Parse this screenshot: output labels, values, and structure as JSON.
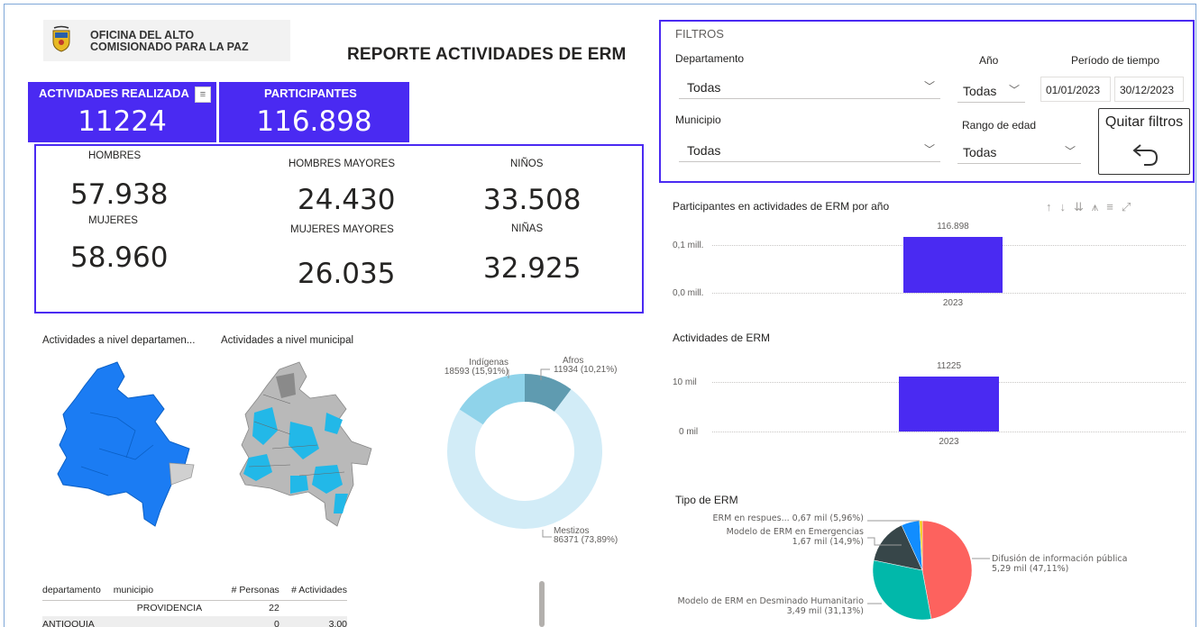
{
  "header": {
    "org_line1": "OFICINA DEL ALTO",
    "org_line2": "COMISIONADO PARA LA PAZ",
    "report_title": "REPORTE ACTIVIDADES DE ERM"
  },
  "kpis": {
    "actividades_label": "ACTIVIDADES REALIZADA",
    "actividades_value": "11224",
    "participantes_label": "PARTICIPANTES",
    "participantes_value": "116.898"
  },
  "stats": {
    "hombres_label": "HOMBRES",
    "hombres_value": "57.938",
    "mujeres_label": "MUJERES",
    "mujeres_value": "58.960",
    "hombres_mayores_label": "HOMBRES MAYORES",
    "hombres_mayores_value": "24.430",
    "mujeres_mayores_label": "MUJERES MAYORES",
    "mujeres_mayores_value": "26.035",
    "ninos_label": "NIÑOS",
    "ninos_value": "33.508",
    "ninas_label": "NIÑAS",
    "ninas_value": "32.925"
  },
  "filters": {
    "title": "FILTROS",
    "departamento_label": "Departamento",
    "departamento_value": "Todas",
    "anio_label": "Año",
    "anio_value": "Todas",
    "periodo_label": "Período de tiempo",
    "fecha_inicio": "01/01/2023",
    "fecha_fin": "30/12/2023",
    "municipio_label": "Municipio",
    "municipio_value": "Todas",
    "rango_label": "Rango de edad",
    "rango_value": "Todas",
    "clear_label": "Quitar filtros"
  },
  "maps": {
    "dept_title": "Actividades a nivel departamen...",
    "muni_title": "Actividades a nivel municipal"
  },
  "donut": {
    "indigenas_name": "Indígenas",
    "indigenas_value": "18593 (15,91%)",
    "afros_name": "Afros",
    "afros_value": "11934 (10,21%)",
    "mestizos_name": "Mestizos",
    "mestizos_value": "86371 (73,89%)",
    "colors": {
      "indigenas": "#8fd3ea",
      "afros": "#5f9bb0",
      "mestizos": "#d2ecf7"
    }
  },
  "chart_data": [
    {
      "type": "bar",
      "title": "Participantes en actividades de ERM por año",
      "categories": [
        "2023"
      ],
      "values": [
        116898
      ],
      "data_labels": [
        "116.898"
      ],
      "y_ticks": [
        "0,0 mill.",
        "0,1 mill."
      ],
      "ylim": [
        0,
        120000
      ]
    },
    {
      "type": "bar",
      "title": "Actividades de ERM",
      "categories": [
        "2023"
      ],
      "values": [
        11225
      ],
      "data_labels": [
        "11225"
      ],
      "y_ticks": [
        "0 mil",
        "10 mil"
      ],
      "ylim": [
        0,
        12500
      ]
    },
    {
      "type": "pie",
      "title": "Tipo de ERM",
      "labels": [
        "Difusión de información pública",
        "Modelo de ERM en Desminado Humanitario",
        "Modelo de ERM en Emergencias",
        "ERM en respues..."
      ],
      "values": [
        47.11,
        31.13,
        14.9,
        5.96
      ],
      "value_labels": [
        "5,29 mil (47,11%)",
        "3,49 mil (31,13%)",
        "1,67 mil (14,9%)",
        "0,67 mil (5,96%)"
      ],
      "colors": [
        "#fd625e",
        "#01b8aa",
        "#374649",
        "#118dff",
        "#f2c80f"
      ]
    }
  ],
  "table": {
    "headers": [
      "departamento",
      "municipio",
      "# Personas",
      "# Actividades"
    ],
    "rows": [
      [
        "",
        "PROVIDENCIA",
        "22",
        ""
      ],
      [
        "ANTIOQUIA",
        "",
        "0",
        "3,00"
      ]
    ]
  }
}
